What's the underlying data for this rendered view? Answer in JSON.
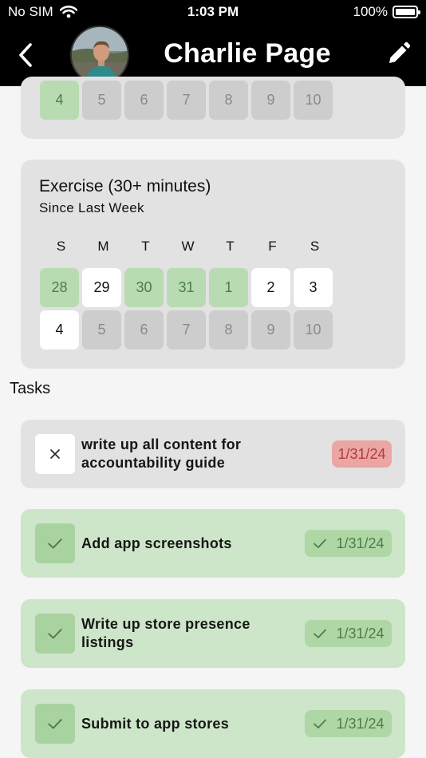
{
  "status_bar": {
    "carrier": "No SIM",
    "time": "1:03 PM",
    "battery": "100%"
  },
  "header": {
    "title": "Charlie Page"
  },
  "top_habit": {
    "days": [
      {
        "label": "4",
        "state": "done"
      },
      {
        "label": "5",
        "state": "future"
      },
      {
        "label": "6",
        "state": "future"
      },
      {
        "label": "7",
        "state": "future"
      },
      {
        "label": "8",
        "state": "future"
      },
      {
        "label": "9",
        "state": "future"
      },
      {
        "label": "10",
        "state": "future"
      }
    ]
  },
  "exercise_habit": {
    "title": "Exercise (30+ minutes)",
    "subtitle": "Since Last Week",
    "weekdays": [
      "S",
      "M",
      "T",
      "W",
      "T",
      "F",
      "S"
    ],
    "days": [
      {
        "label": "28",
        "state": "done"
      },
      {
        "label": "29",
        "state": "open"
      },
      {
        "label": "30",
        "state": "done"
      },
      {
        "label": "31",
        "state": "done"
      },
      {
        "label": "1",
        "state": "done"
      },
      {
        "label": "2",
        "state": "open"
      },
      {
        "label": "3",
        "state": "open"
      },
      {
        "label": "4",
        "state": "open"
      },
      {
        "label": "5",
        "state": "future"
      },
      {
        "label": "6",
        "state": "future"
      },
      {
        "label": "7",
        "state": "future"
      },
      {
        "label": "8",
        "state": "future"
      },
      {
        "label": "9",
        "state": "future"
      },
      {
        "label": "10",
        "state": "future"
      }
    ]
  },
  "tasks_label": "Tasks",
  "tasks": [
    {
      "text": "write up all content for accountability guide",
      "date": "1/31/24",
      "completed": false
    },
    {
      "text": "Add app screenshots",
      "date": "1/31/24",
      "completed": true
    },
    {
      "text": "Write up store presence listings",
      "date": "1/31/24",
      "completed": true
    },
    {
      "text": "Submit to app stores",
      "date": "1/31/24",
      "completed": true
    }
  ],
  "colors": {
    "done_green": "#b9dbb2",
    "task_done_bg": "#cde5c8",
    "overdue_red": "#eba5a5",
    "header_bg": "#000000"
  }
}
